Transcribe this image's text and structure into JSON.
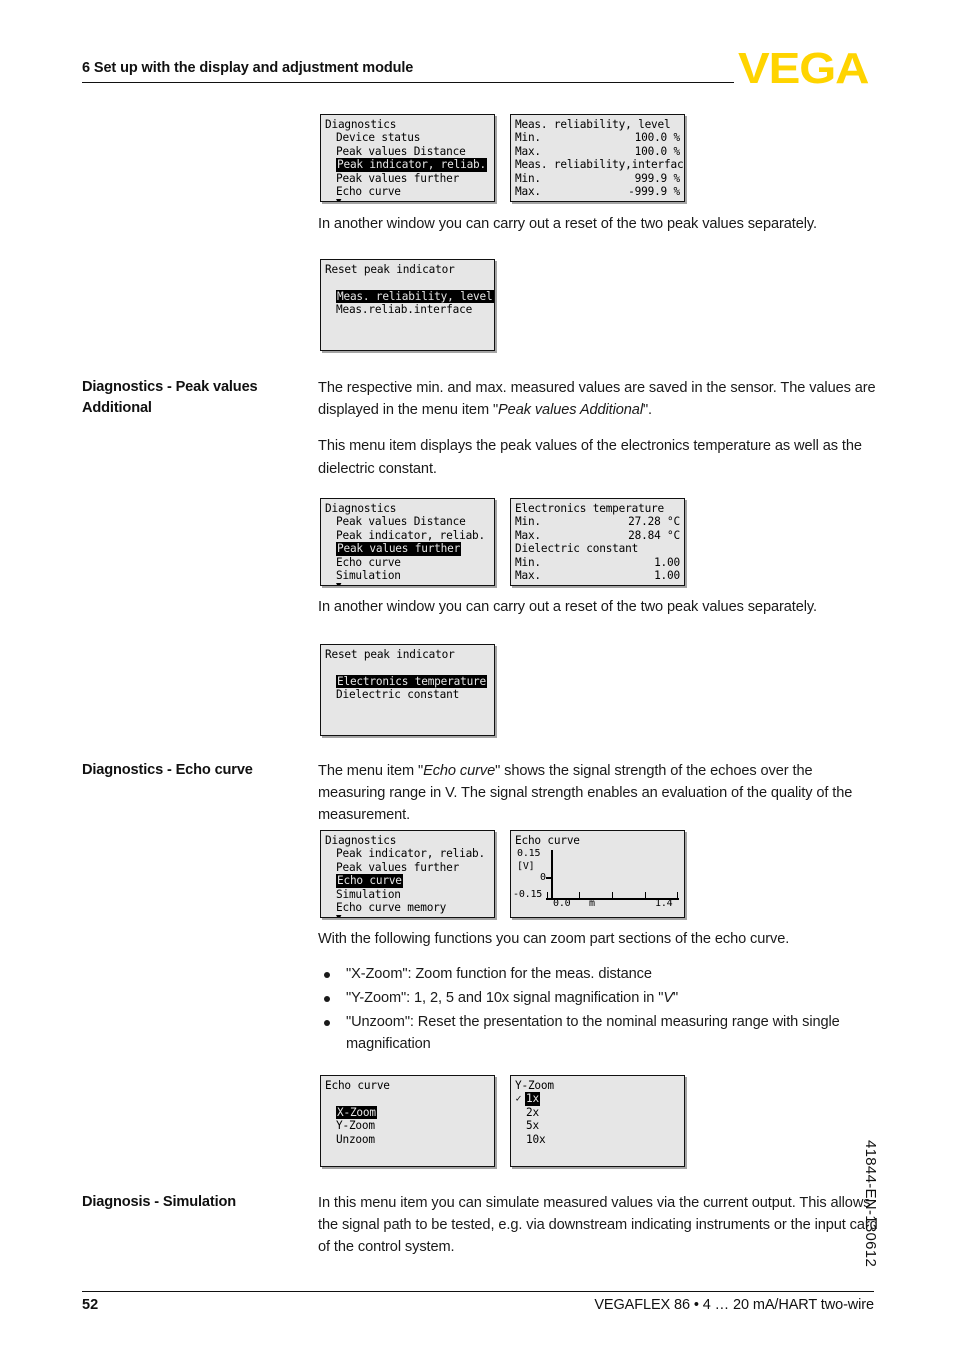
{
  "header": {
    "chapter_title": "6 Set up with the display and adjustment module",
    "logo_text": "VEGA",
    "logo_color": "#FFD400"
  },
  "footer": {
    "page_number": "52",
    "document_line": "VEGAFLEX 86 • 4 … 20 mA/HART two-wire",
    "side_code": "41844-EN-130612"
  },
  "sections": {
    "peak_reliab": {
      "intro_text": "In another window you can carry out a reset of the two peak values separately."
    },
    "peak_values_additional": {
      "label": "Diagnostics - Peak values Additional",
      "label_line1": "Diagnostics - Peak values",
      "label_line2": "Additional",
      "para1_a": "The respective min. and max. measured values are saved in the sensor. The values are displayed in the menu item \"",
      "para1_italic": "Peak values Additional",
      "para1_b": "\".",
      "para2": "This menu item displays the peak values of the electronics temperature as well as the dielectric constant.",
      "para3": "In another window you can carry out a reset of the two peak values separately."
    },
    "echo_curve": {
      "label": "Diagnostics - Echo curve",
      "para1_a": "The menu item \"",
      "para1_italic": "Echo curve",
      "para1_b": "\" shows the signal strength of the echoes over the measuring range in V. The signal strength enables an evaluation of the quality of the measurement.",
      "para2": "With the following functions you can zoom part sections of the echo curve.",
      "bullets": [
        {
          "a": "\"X-Zoom\": Zoom function for the meas. distance",
          "italic": "",
          "b": ""
        },
        {
          "a": "\"Y-Zoom\": 1, 2, 5 and 10x signal magnification in \"",
          "italic": "V",
          "b": "\""
        },
        {
          "a": "\"Unzoom\": Reset the presentation to the nominal measuring range with single magnification",
          "italic": "",
          "b": ""
        }
      ]
    },
    "simulation": {
      "label": "Diagnosis - Simulation",
      "para1": "In this menu item you can simulate measured values via the current output. This allows the signal path to be tested, e.g. via downstream indicating instruments or the input card of the control system."
    }
  },
  "lcd": {
    "diag_menu_1": {
      "title": "Diagnostics",
      "items": [
        {
          "label": "Device status",
          "selected": false
        },
        {
          "label": "Peak values Distance",
          "selected": false
        },
        {
          "label": "Peak indicator, reliab.",
          "selected": true
        },
        {
          "label": "Peak values further",
          "selected": false
        },
        {
          "label": "Echo curve",
          "selected": false
        }
      ],
      "more_arrow": "▼"
    },
    "meas_reliability": {
      "group1_title": "Meas. reliability, level",
      "group1_rows": [
        {
          "key": "Min.",
          "value": "100.0 %"
        },
        {
          "key": "Max.",
          "value": "100.0 %"
        }
      ],
      "group2_title": "Meas. reliability,interface",
      "group2_rows": [
        {
          "key": "Min.",
          "value": "999.9 %"
        },
        {
          "key": "Max.",
          "value": "-999.9 %"
        }
      ]
    },
    "reset_peak_1": {
      "title": "Reset peak indicator",
      "items": [
        {
          "label": "Meas. reliability, level",
          "selected": true
        },
        {
          "label": "Meas.reliab.interface",
          "selected": false
        }
      ]
    },
    "diag_menu_2": {
      "title": "Diagnostics",
      "items": [
        {
          "label": "Peak values Distance",
          "selected": false
        },
        {
          "label": "Peak indicator, reliab.",
          "selected": false
        },
        {
          "label": "Peak values further",
          "selected": true
        },
        {
          "label": "Echo curve",
          "selected": false
        },
        {
          "label": "Simulation",
          "selected": false
        }
      ],
      "more_arrow": "▼"
    },
    "electronics_temp": {
      "group1_title": "Electronics temperature",
      "group1_rows": [
        {
          "key": "Min.",
          "value": "27.28 °C"
        },
        {
          "key": "Max.",
          "value": "28.84 °C"
        }
      ],
      "group2_title": "Dielectric constant",
      "group2_rows": [
        {
          "key": "Min.",
          "value": "1.00"
        },
        {
          "key": "Max.",
          "value": "1.00"
        }
      ]
    },
    "reset_peak_2": {
      "title": "Reset peak indicator",
      "items": [
        {
          "label": "Electronics temperature",
          "selected": true
        },
        {
          "label": "Dielectric constant",
          "selected": false
        }
      ]
    },
    "diag_menu_3": {
      "title": "Diagnostics",
      "items": [
        {
          "label": "Peak indicator, reliab.",
          "selected": false
        },
        {
          "label": "Peak values further",
          "selected": false
        },
        {
          "label": "Echo curve",
          "selected": true
        },
        {
          "label": "Simulation",
          "selected": false
        },
        {
          "label": "Echo curve memory",
          "selected": false
        }
      ],
      "more_arrow": "▼"
    },
    "echo_curve_menu": {
      "title": "Echo curve",
      "items": [
        {
          "label": "X-Zoom",
          "selected": true
        },
        {
          "label": "Y-Zoom",
          "selected": false
        },
        {
          "label": "Unzoom",
          "selected": false
        }
      ]
    },
    "y_zoom_menu": {
      "title": "Y-Zoom",
      "items": [
        {
          "label": "1x",
          "selected": true,
          "checked": true
        },
        {
          "label": "2x",
          "selected": false,
          "checked": false
        },
        {
          "label": "5x",
          "selected": false,
          "checked": false
        },
        {
          "label": "10x",
          "selected": false,
          "checked": false
        }
      ]
    }
  },
  "chart_data": {
    "type": "line",
    "title": "Echo curve",
    "ylabel": "[V]",
    "xlabel": "m",
    "ylim": [
      -0.15,
      0.15
    ],
    "ytick_labels": [
      "0.15",
      "[V]",
      "0",
      "-0.15"
    ],
    "xlim": [
      0.0,
      1.4
    ],
    "xtick_labels": [
      "0.0",
      "1.4"
    ],
    "xtick_count": 5,
    "grid": false,
    "series": [
      {
        "name": "Echo curve",
        "x": [],
        "values": []
      }
    ]
  }
}
